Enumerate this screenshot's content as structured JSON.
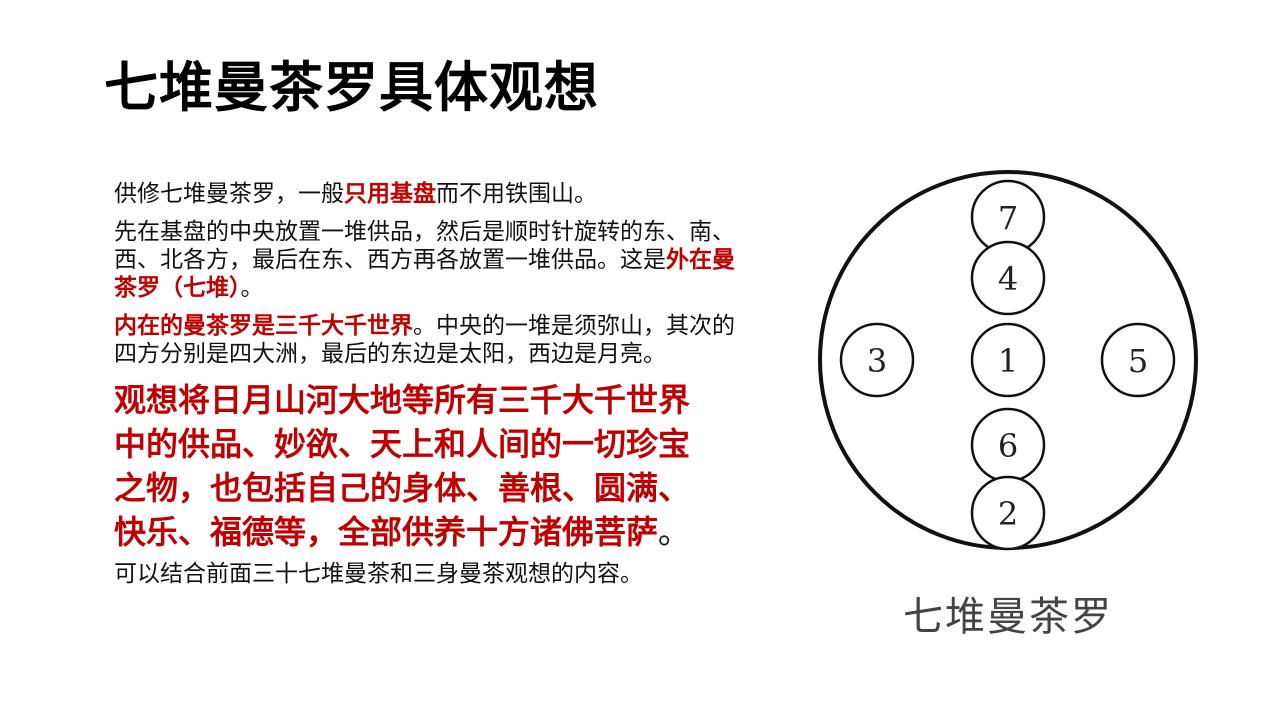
{
  "title": "七堆曼茶罗具体观想",
  "paragraphs": {
    "p1": {
      "a": "供修七堆曼茶罗，一般",
      "b": "只用基盘",
      "c": "而不用铁围山。"
    },
    "p2": {
      "a": "先在基盘的中央放置一堆供品，然后是顺时针旋转的东、南、西、北各方，最后在东、西方再各放置一堆供品。这是",
      "b": "外在曼茶罗（七堆）",
      "c": "。"
    },
    "p3": {
      "a": "内在的曼茶罗是三千大千世界",
      "b": "。中央的一堆是须弥山，其次的四方分别是四大洲，最后的东边是太阳，西边是月亮。"
    },
    "p4": {
      "a": "观想将日月山河大地等所有三千大千世界中的供品、妙欲、天上和人间的一切珍宝之物，也包括自己的身体、善根、圆满、快乐、福德等，全部供养十方诸佛菩萨",
      "b": "。"
    },
    "p5": "可以结合前面三十七堆曼茶和三身曼茶观想的内容。"
  },
  "diagram": {
    "labels": {
      "n1": "1",
      "n2": "2",
      "n3": "3",
      "n4": "4",
      "n5": "5",
      "n6": "6",
      "n7": "7"
    },
    "caption": "七堆曼茶罗"
  },
  "colors": {
    "accent_red": "#c00000",
    "text": "#111111"
  }
}
